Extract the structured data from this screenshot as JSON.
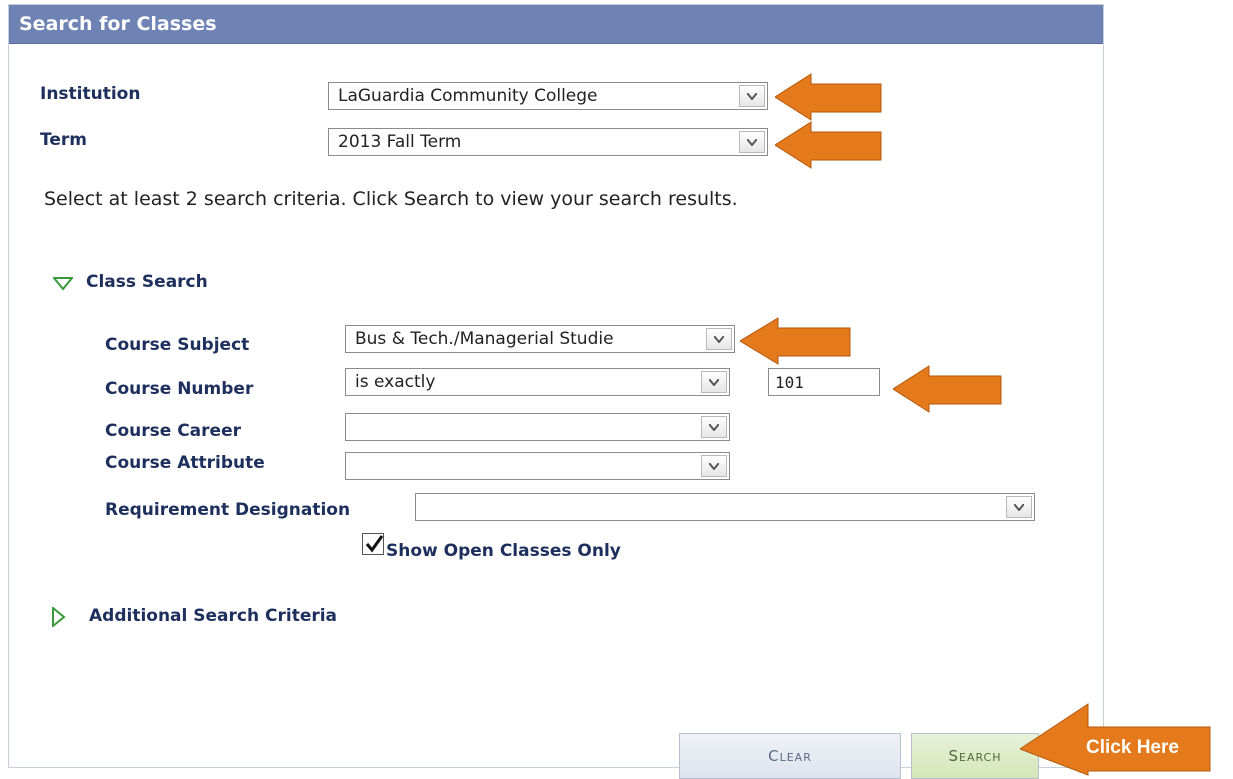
{
  "window": {
    "title": "Search for Classes"
  },
  "form": {
    "institution": {
      "label": "Institution",
      "value": "LaGuardia Community College"
    },
    "term": {
      "label": "Term",
      "value": "2013 Fall Term"
    },
    "instructions": "Select at least 2 search criteria. Click Search to view your search results."
  },
  "class_search": {
    "title": "Class Search",
    "course_subject": {
      "label": "Course Subject",
      "value": "Bus & Tech./Managerial Studie"
    },
    "course_number": {
      "label": "Course Number",
      "operator": "is exactly",
      "value": "101"
    },
    "course_career": {
      "label": "Course Career",
      "value": ""
    },
    "course_attribute": {
      "label": "Course Attribute",
      "value": ""
    },
    "requirement_designation": {
      "label": "Requirement Designation",
      "value": ""
    },
    "open_only": {
      "label": "Show Open Classes Only",
      "checked": true
    }
  },
  "additional": {
    "title": "Additional Search Criteria"
  },
  "buttons": {
    "clear": "Clear",
    "search": "Search"
  },
  "callout": {
    "text": "Click Here"
  },
  "colors": {
    "header": "#6e82b4",
    "label": "#1d2f5c",
    "arrow": "#e47a1c",
    "clear_btn": "#e2e7f0",
    "search_btn": "#d9e8c0"
  }
}
